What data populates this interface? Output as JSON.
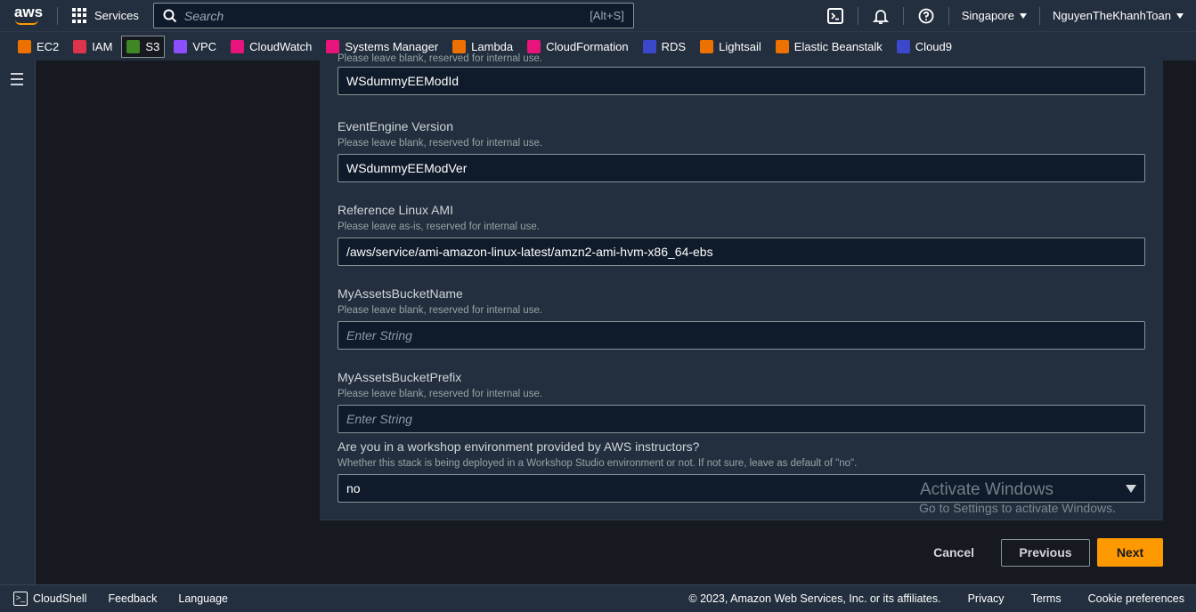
{
  "topnav": {
    "logo_text": "aws",
    "services_label": "Services",
    "search_placeholder": "Search",
    "search_shortcut": "[Alt+S]",
    "region": "Singapore",
    "user": "NguyenTheKhanhToan"
  },
  "favorites": [
    {
      "label": "EC2",
      "color": "#ed7100"
    },
    {
      "label": "IAM",
      "color": "#dd344c"
    },
    {
      "label": "S3",
      "color": "#3f8624"
    },
    {
      "label": "VPC",
      "color": "#8c4fff"
    },
    {
      "label": "CloudWatch",
      "color": "#e7157b"
    },
    {
      "label": "Systems Manager",
      "color": "#e7157b"
    },
    {
      "label": "Lambda",
      "color": "#ed7100"
    },
    {
      "label": "CloudFormation",
      "color": "#e7157b"
    },
    {
      "label": "RDS",
      "color": "#3b48cc"
    },
    {
      "label": "Lightsail",
      "color": "#ed7100"
    },
    {
      "label": "Elastic Beanstalk",
      "color": "#ed7100"
    },
    {
      "label": "Cloud9",
      "color": "#3b48cc"
    }
  ],
  "form": {
    "partial_desc": "Please leave blank, reserved for internal use.",
    "field0_value": "WSdummyEEModId",
    "fields": [
      {
        "label": "EventEngine Version",
        "desc": "Please leave blank, reserved for internal use.",
        "value": "WSdummyEEModVer"
      },
      {
        "label": "Reference Linux AMI",
        "desc": "Please leave as-is, reserved for internal use.",
        "value": "/aws/service/ami-amazon-linux-latest/amzn2-ami-hvm-x86_64-ebs"
      },
      {
        "label": "MyAssetsBucketName",
        "desc": "Please leave blank, reserved for internal use.",
        "placeholder": "Enter String"
      },
      {
        "label": "MyAssetsBucketPrefix",
        "desc": "Please leave blank, reserved for internal use.",
        "placeholder": "Enter String"
      },
      {
        "label": "Are you in a workshop environment provided by AWS instructors?",
        "desc": "Whether this stack is being deployed in a Workshop Studio environment or not. If not sure, leave as default of \"no\".",
        "value": "no"
      }
    ]
  },
  "actions": {
    "cancel": "Cancel",
    "previous": "Previous",
    "next": "Next"
  },
  "watermark": {
    "line1": "Activate Windows",
    "line2": "Go to Settings to activate Windows."
  },
  "footer": {
    "cloudshell": "CloudShell",
    "feedback": "Feedback",
    "language": "Language",
    "copyright": "© 2023, Amazon Web Services, Inc. or its affiliates.",
    "privacy": "Privacy",
    "terms": "Terms",
    "cookies": "Cookie preferences"
  }
}
